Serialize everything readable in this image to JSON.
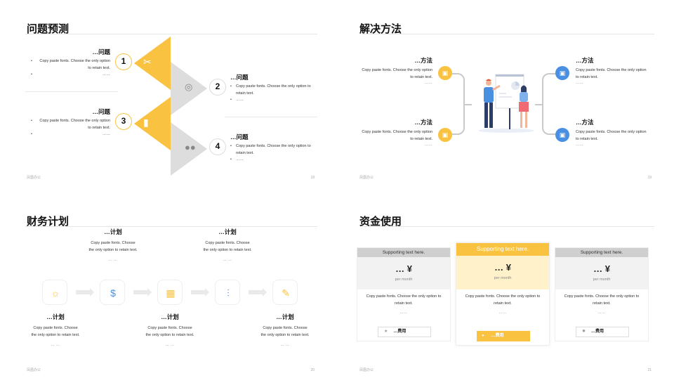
{
  "slide1": {
    "title": "问题预测",
    "items": [
      {
        "num": "1",
        "heading": "…问题",
        "body": "Copy paste fonts. Choose the only option to retain text.",
        "dots": "……"
      },
      {
        "num": "2",
        "heading": "…问题",
        "body": "Copy paste fonts. Choose the only option to retain text.",
        "dots": "……"
      },
      {
        "num": "3",
        "heading": "…问题",
        "body": "Copy paste fonts. Choose the only option to retain text.",
        "dots": "……"
      },
      {
        "num": "4",
        "heading": "…问题",
        "body": "Copy paste fonts. Choose the only option to retain text.",
        "dots": "……"
      }
    ],
    "icons": [
      "tools-icon",
      "target-icon",
      "growth-icon",
      "people-icon"
    ],
    "footer": "凤凰办公",
    "page": "18"
  },
  "slide2": {
    "title": "解决方法",
    "items": [
      {
        "heading": "…方法",
        "body": "Copy paste fonts. Choose the only option to retain text.",
        "dots": "……"
      },
      {
        "heading": "…方法",
        "body": "Copy paste fonts. Choose the only option to retain text.",
        "dots": "……"
      },
      {
        "heading": "…方法",
        "body": "Copy paste fonts. Choose the only option to retain text.",
        "dots": "……"
      },
      {
        "heading": "…方法",
        "body": "Copy paste fonts. Choose the only option to retain text.",
        "dots": "……"
      }
    ],
    "footer": "凤凰办公",
    "page": "19"
  },
  "slide3": {
    "title": "财务计划",
    "top": [
      {
        "heading": "…计划",
        "body": "Copy paste fonts. Choose the only option to retain text.",
        "dots": "… …"
      },
      {
        "heading": "…计划",
        "body": "Copy paste fonts. Choose the only option to retain text.",
        "dots": "… …"
      }
    ],
    "bottom": [
      {
        "heading": "…计划",
        "body": "Copy paste fonts. Choose the only option to retain text.",
        "dots": "… …"
      },
      {
        "heading": "…计划",
        "body": "Copy paste fonts. Choose the only option to retain text.",
        "dots": "… …"
      },
      {
        "heading": "…计划",
        "body": "Copy paste fonts. Choose the only option to retain text.",
        "dots": "… …"
      }
    ],
    "footer": "凤凰办公",
    "page": "20"
  },
  "slide4": {
    "title": "资金使用",
    "cards": [
      {
        "band": "Supporting text here.",
        "price": "… ¥",
        "period": "per month",
        "body": "Copy paste fonts. Choose the only option to retain text.",
        "dots": "……",
        "button": "…费用"
      },
      {
        "band": "Supporting text here.",
        "price": "… ¥",
        "period": "per month",
        "body": "Copy paste fonts. Choose the only option to retain text.",
        "dots": "……",
        "button": "…费用"
      },
      {
        "band": "Supporting text here.",
        "price": "… ¥",
        "period": "per month",
        "body": "Copy paste fonts. Choose the only option to retain text.",
        "dots": "……",
        "button": "…费用"
      }
    ],
    "footer": "凤凰办公",
    "page": "21"
  },
  "colors": {
    "accent": "#f9c341",
    "blue": "#4a90e2",
    "gray": "#dddddd"
  }
}
